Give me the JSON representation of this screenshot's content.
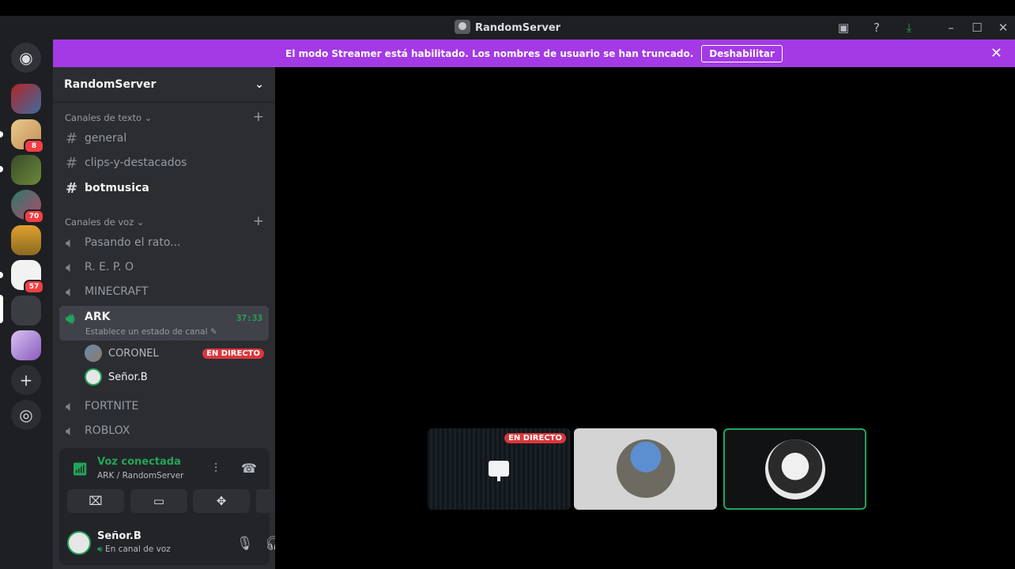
{
  "window": {
    "title": "RandomServer"
  },
  "banner": {
    "message": "El modo Streamer está habilitado. Los nombres de usuario se han truncado.",
    "button_label": "Deshabilitar"
  },
  "rail": {
    "badges": [
      "8",
      "70",
      "57"
    ]
  },
  "sidebar": {
    "server_name": "RandomServer",
    "text_category": "Canales de texto",
    "text_channels": [
      "general",
      "clips-y-destacados",
      "botmusica"
    ],
    "voice_category": "Canales de voz",
    "voice_channels": [
      "Pasando el rato...",
      "R. E. P. O",
      "MINECRAFT"
    ],
    "active_channel": {
      "name": "ARK",
      "timer": "37:33",
      "status_hint": "Establece un estado de canal"
    },
    "voice_users": [
      {
        "name": "CORONEL",
        "tag": "EN DIRECTO"
      },
      {
        "name": "Señor.B"
      }
    ],
    "more_voice_channels": [
      "FORTNITE",
      "ROBLOX"
    ]
  },
  "voice_panel": {
    "status": "Voz conectada",
    "location": "ARK / RandomServer"
  },
  "user": {
    "name": "Señor.B",
    "status": "En canal de voz"
  },
  "stage": {
    "live_label": "EN DIRECTO"
  },
  "colors": {
    "accent_green": "#23a55a",
    "banner_purple": "#a33ae5",
    "live_red": "#da373c"
  }
}
